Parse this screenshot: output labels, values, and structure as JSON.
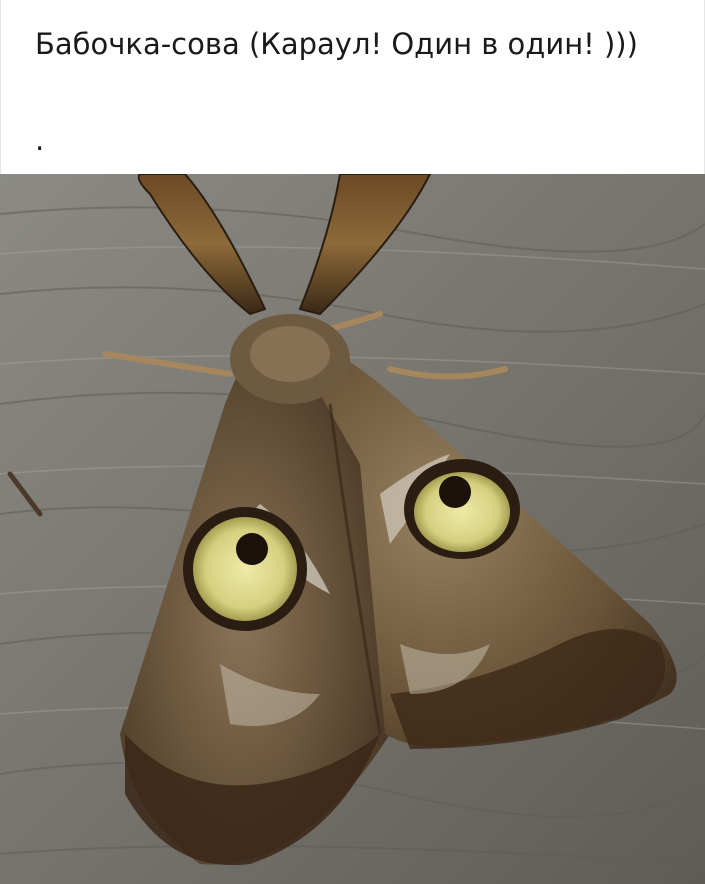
{
  "post": {
    "caption": "Бабочка-сова  (Караул! Один в один! )))",
    "dot": "."
  },
  "photo": {
    "subject_icon": "owl-moth-photo"
  },
  "colors": {
    "background": "#ffffff",
    "text": "#1a1a1a",
    "wood": "#7d7c77",
    "moth_brown": "#5a4530",
    "eye_yellow": "#dcd88e"
  }
}
